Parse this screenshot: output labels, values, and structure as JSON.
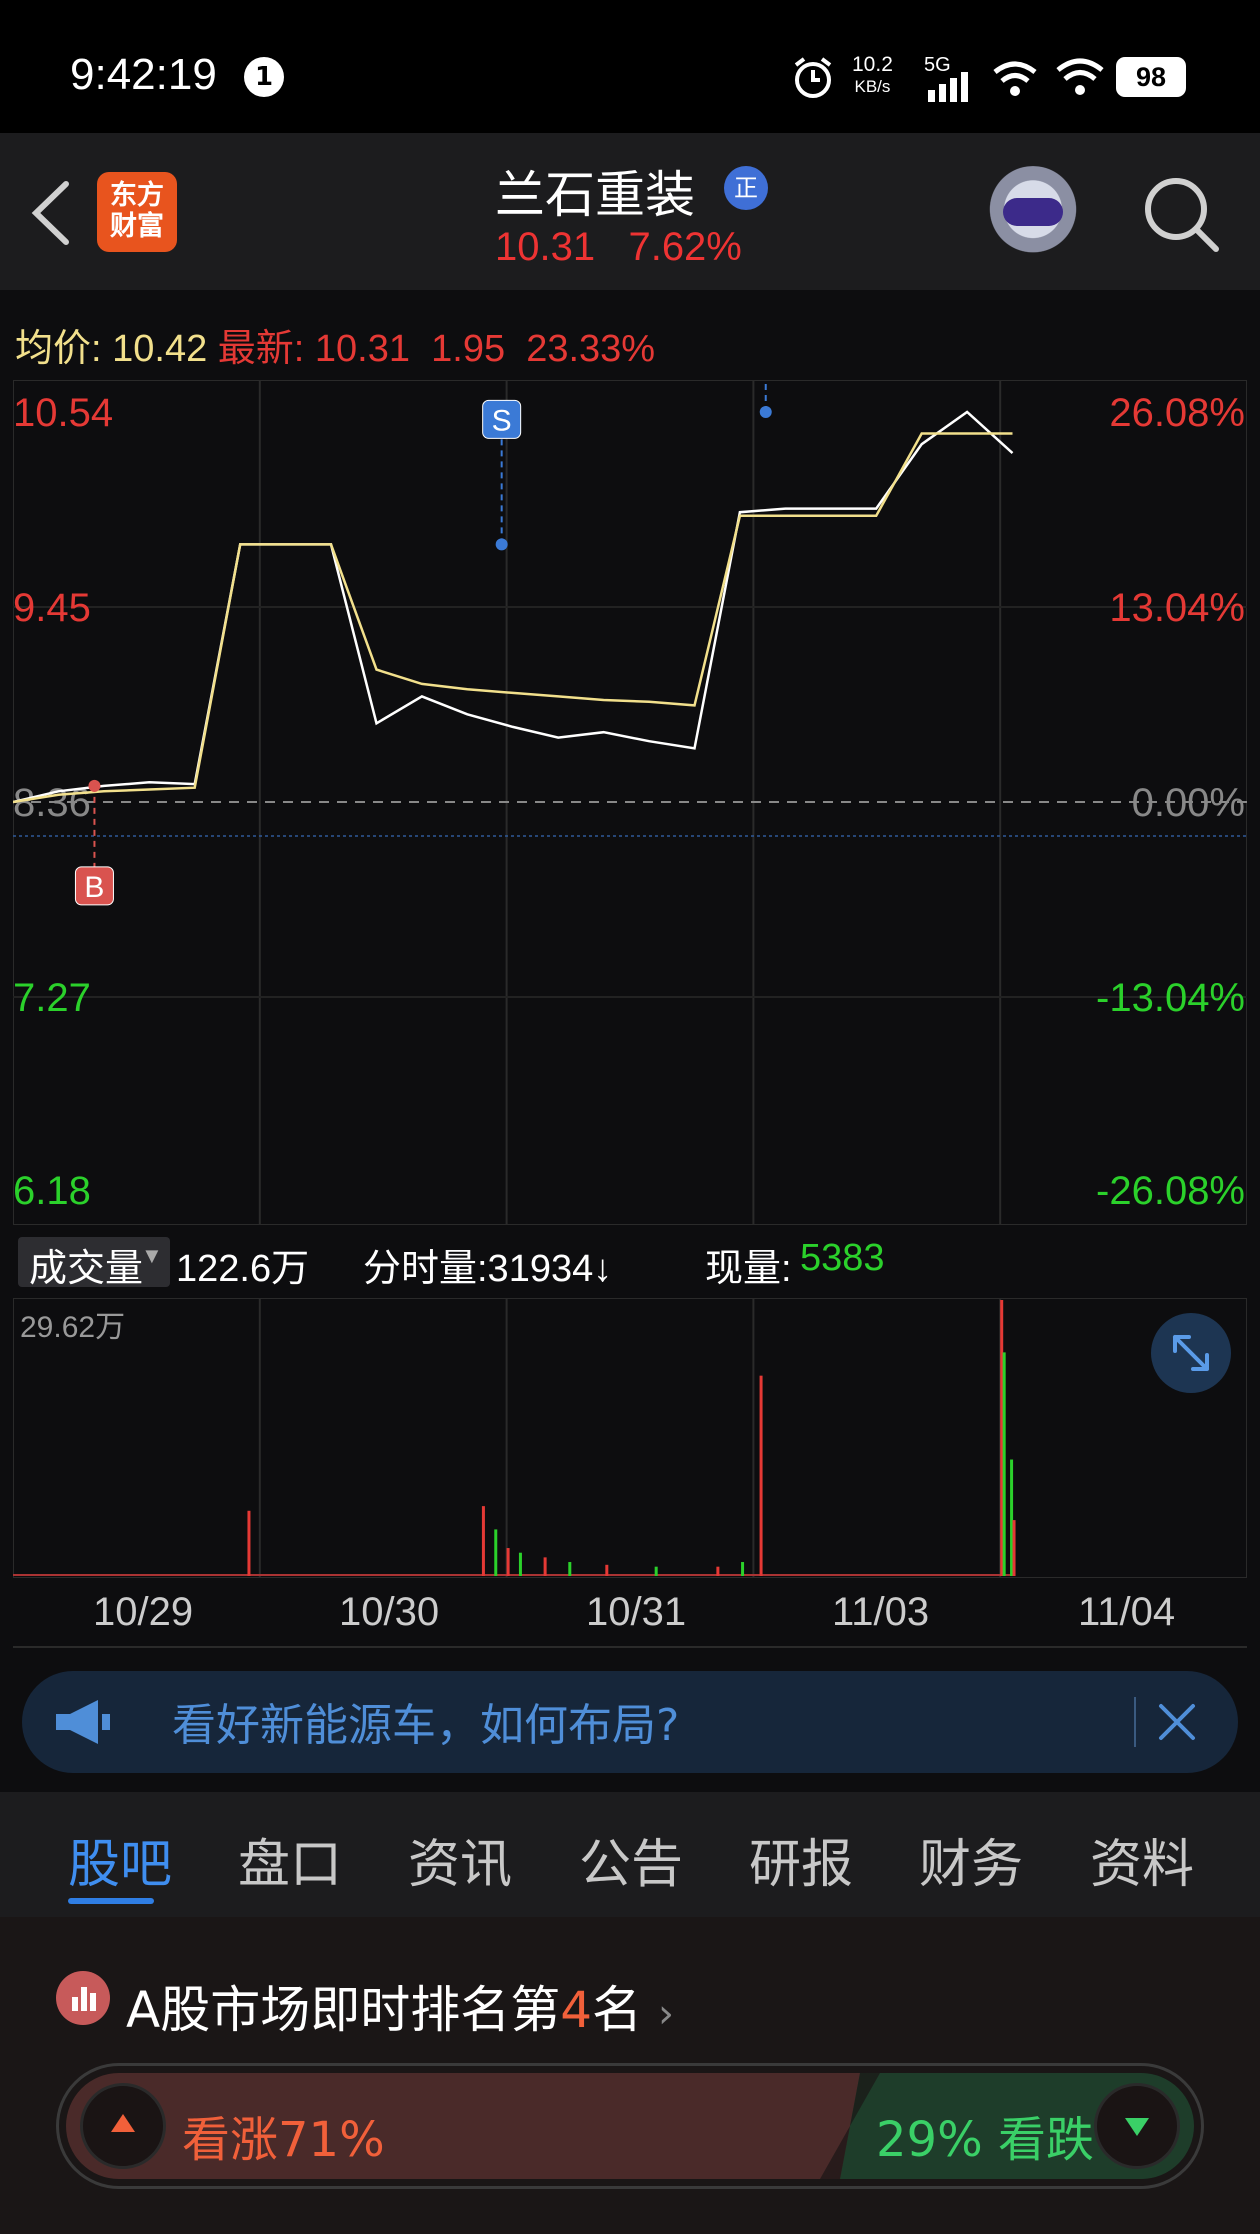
{
  "status_bar": {
    "time": "9:42:19",
    "notification_count": "1",
    "net_speed_value": "10.2",
    "net_speed_unit": "KB/s",
    "network": "5G",
    "battery": "98"
  },
  "header": {
    "logo_line1": "东方",
    "logo_line2": "财富",
    "title": "兰石重装",
    "badge": "正",
    "price": "10.31",
    "change_pct": "7.62%"
  },
  "info": {
    "avg_label": "均价:",
    "avg_value": "10.42",
    "latest_label": "最新:",
    "latest_price": "10.31",
    "latest_change": "1.95",
    "latest_pct": "23.33%"
  },
  "chart_data": {
    "type": "line",
    "title": "",
    "x_dates": [
      "10/29",
      "10/30",
      "10/31",
      "11/03",
      "11/04"
    ],
    "y_left_ticks": [
      "10.54",
      "9.45",
      "8.36",
      "7.27",
      "6.18"
    ],
    "y_right_ticks": [
      "26.08%",
      "13.04%",
      "0.00%",
      "-13.04%",
      "-26.08%"
    ],
    "ylim": [
      6.18,
      10.54
    ],
    "base_price": 8.36,
    "series": [
      {
        "values": [
          8.36,
          8.42,
          8.45,
          8.47,
          8.46,
          9.8,
          9.8,
          9.8,
          8.8,
          8.95,
          8.85,
          8.78,
          8.72,
          8.75,
          8.7,
          8.66,
          9.98,
          10.0,
          10.0,
          10.0,
          10.36,
          10.54,
          10.31
        ],
        "color": "#ffffff"
      },
      {
        "values": [
          8.36,
          8.4,
          8.42,
          8.43,
          8.44,
          9.8,
          9.8,
          9.8,
          9.1,
          9.02,
          8.99,
          8.97,
          8.95,
          8.93,
          8.92,
          8.9,
          9.96,
          9.96,
          9.96,
          9.96,
          10.42,
          10.42,
          10.42
        ],
        "color": "#f2e08c"
      }
    ],
    "markers": [
      {
        "label": "B",
        "day": "10/29",
        "price": 8.45,
        "type": "buy"
      },
      {
        "label": "S",
        "day": "10/30",
        "price": 9.8,
        "type": "sell"
      },
      {
        "label": "S",
        "day": "11/04",
        "price": 10.54,
        "type": "sell"
      }
    ]
  },
  "volume": {
    "selector_label": "成交量",
    "total": "122.6万",
    "tick_label": "分时量:31934↓",
    "current_label": "现量:",
    "current_value": "5383",
    "max_label": "29.62万",
    "max_value": 29.62,
    "bars": [
      {
        "pos": 0.19,
        "value": 7,
        "color": "#e53935"
      },
      {
        "pos": 0.38,
        "value": 7.5,
        "color": "#e53935"
      },
      {
        "pos": 0.39,
        "value": 5,
        "color": "#2bd12b"
      },
      {
        "pos": 0.4,
        "value": 3,
        "color": "#e53935"
      },
      {
        "pos": 0.41,
        "value": 2.5,
        "color": "#2bd12b"
      },
      {
        "pos": 0.43,
        "value": 2,
        "color": "#e53935"
      },
      {
        "pos": 0.45,
        "value": 1.5,
        "color": "#2bd12b"
      },
      {
        "pos": 0.48,
        "value": 1.2,
        "color": "#e53935"
      },
      {
        "pos": 0.52,
        "value": 1,
        "color": "#2bd12b"
      },
      {
        "pos": 0.57,
        "value": 1,
        "color": "#e53935"
      },
      {
        "pos": 0.59,
        "value": 1.5,
        "color": "#2bd12b"
      },
      {
        "pos": 0.605,
        "value": 21.5,
        "color": "#e53935"
      },
      {
        "pos": 0.8,
        "value": 29.62,
        "color": "#e53935"
      },
      {
        "pos": 0.802,
        "value": 24,
        "color": "#2bd12b"
      },
      {
        "pos": 0.808,
        "value": 12.5,
        "color": "#2bd12b"
      },
      {
        "pos": 0.81,
        "value": 6,
        "color": "#e53935"
      }
    ]
  },
  "banner": {
    "text": "看好新能源车，如何布局?"
  },
  "tabs": [
    {
      "label": "股吧",
      "active": true
    },
    {
      "label": "盘口"
    },
    {
      "label": "资讯"
    },
    {
      "label": "公告"
    },
    {
      "label": "研报"
    },
    {
      "label": "财务"
    },
    {
      "label": "资料"
    }
  ],
  "ranking": {
    "prefix": "A股市场即时排名第",
    "rank": "4",
    "suffix": "名"
  },
  "vote": {
    "up_label": "看涨71%",
    "down_label": "29% 看跌",
    "up_fraction": 0.71
  },
  "colors": {
    "up": "#e53935",
    "down": "#2bd12b",
    "avg": "#f2e08c",
    "accent": "#2f7ee4"
  }
}
